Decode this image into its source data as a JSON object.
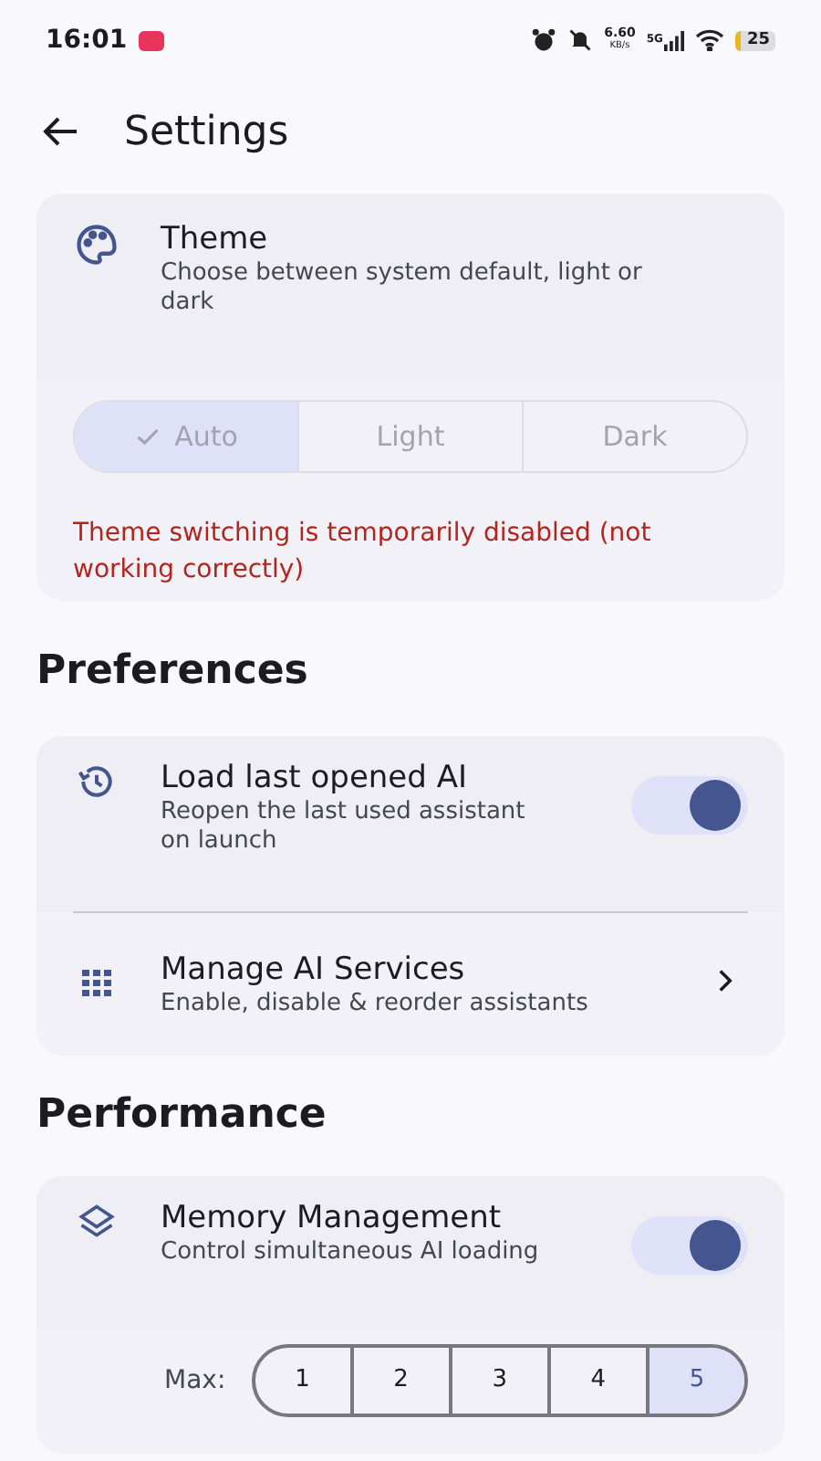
{
  "status_bar": {
    "time": "16:01",
    "speed": "6.60",
    "speed_unit": "KB/s",
    "network": "5G",
    "battery": "25"
  },
  "header": {
    "title": "Settings"
  },
  "theme": {
    "title": "Theme",
    "description": "Choose between system default, light or dark",
    "options": [
      {
        "label": "Auto",
        "selected": true
      },
      {
        "label": "Light",
        "selected": false
      },
      {
        "label": "Dark",
        "selected": false
      }
    ],
    "warning": "Theme switching is temporarily disabled (not working correctly)"
  },
  "sections": [
    {
      "title": "Preferences",
      "items": [
        {
          "kind": "toggle",
          "title": "Load last opened AI",
          "description": "Reopen the last used assistant on launch",
          "on": true
        },
        {
          "kind": "link",
          "title": "Manage AI Services",
          "description": "Enable, disable & reorder assistants"
        }
      ]
    },
    {
      "title": "Performance",
      "items": [
        {
          "kind": "toggle",
          "title": "Memory Management",
          "description": "Control simultaneous AI loading",
          "on": true,
          "max_label": "Max:",
          "max_options": [
            {
              "label": "1",
              "selected": false
            },
            {
              "label": "2",
              "selected": false
            },
            {
              "label": "3",
              "selected": false
            },
            {
              "label": "4",
              "selected": false
            },
            {
              "label": "5",
              "selected": true
            }
          ]
        }
      ]
    }
  ]
}
